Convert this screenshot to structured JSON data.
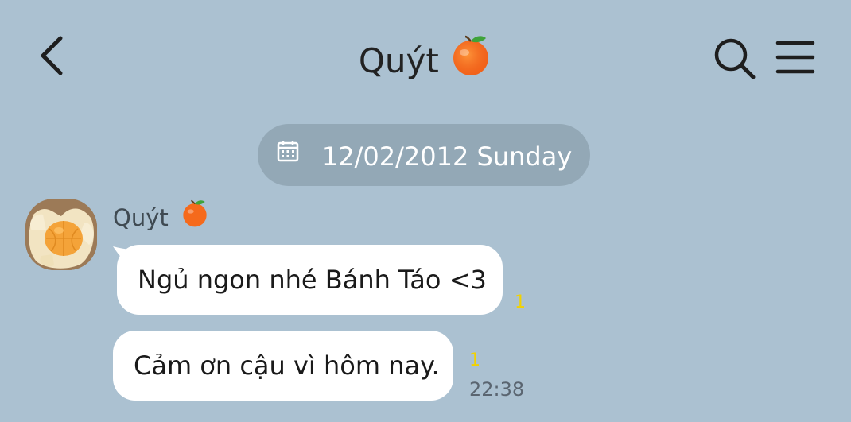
{
  "header": {
    "title": "Quýt",
    "title_emoji": "tangerine-emoji"
  },
  "date_divider": {
    "text": "12/02/2012 Sunday"
  },
  "messages": [
    {
      "sender": "Quýt",
      "text": "Ngủ ngon nhé Bánh Táo <3",
      "unread_count": "1"
    },
    {
      "sender": "Quýt",
      "text": "Cảm ơn cậu vì hôm nay.",
      "unread_count": "1",
      "time": "22:38"
    }
  ],
  "colors": {
    "background": "#abc1d1",
    "date_pill": "#93a8b6",
    "bubble": "#ffffff",
    "unread": "#f2d200"
  }
}
